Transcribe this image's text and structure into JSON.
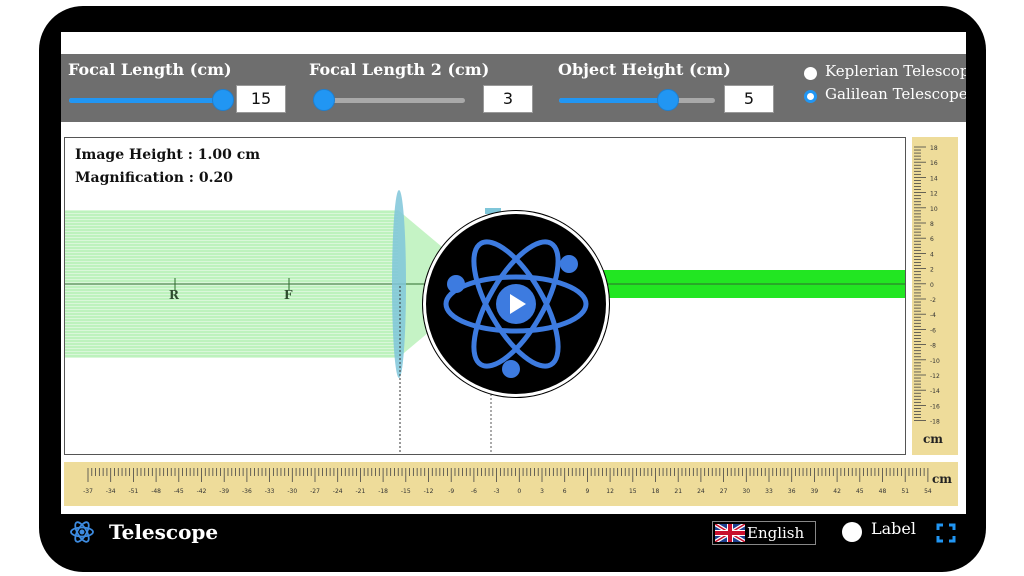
{
  "controls": {
    "focal_length": {
      "label": "Focal Length (cm)",
      "value": "15",
      "slider_fraction": 1.0
    },
    "focal_length_2": {
      "label": "Focal Length 2 (cm)",
      "value": "3",
      "slider_fraction": 0.0
    },
    "object_height": {
      "label": "Object Height (cm)",
      "value": "5",
      "slider_fraction": 0.72
    },
    "telescope_type": {
      "options": [
        "Keplerian Telescope",
        "Galilean Telescope"
      ],
      "selected": "Galilean Telescope"
    }
  },
  "stage": {
    "image_height": "Image Height : 1.00 cm",
    "magnification": "Magnification : 0.20",
    "axis_labels": {
      "r": "R",
      "f": "F"
    }
  },
  "vertical_ruler": {
    "ticks": [
      "18",
      "16",
      "14",
      "12",
      "10",
      "8",
      "6",
      "4",
      "2",
      "0",
      "-2",
      "-4",
      "-6",
      "-8",
      "-10",
      "-12",
      "-14",
      "-16",
      "-18"
    ],
    "unit": "cm"
  },
  "horizontal_ruler": {
    "ticks": [
      "-37",
      "-34",
      "-51",
      "-48",
      "-45",
      "-42",
      "-39",
      "-36",
      "-33",
      "-30",
      "-27",
      "-24",
      "-21",
      "-18",
      "-15",
      "-12",
      "-9",
      "-6",
      "-3",
      "0",
      "3",
      "6",
      "9",
      "12",
      "15",
      "18",
      "21",
      "24",
      "27",
      "30",
      "33",
      "36",
      "39",
      "42",
      "45",
      "48",
      "51",
      "54"
    ],
    "unit": "cm"
  },
  "footer": {
    "title": "Telescope",
    "language": "English",
    "label_toggle": "Label"
  },
  "icons": {
    "app": "atom-icon",
    "play": "play-icon",
    "flag": "uk-flag-icon",
    "fullscreen": "fullscreen-icon"
  },
  "colors": {
    "accent": "#2196f3",
    "ray_green": "#22e622",
    "ruler": "#eedc9a",
    "panel": "#6e6e6e"
  }
}
